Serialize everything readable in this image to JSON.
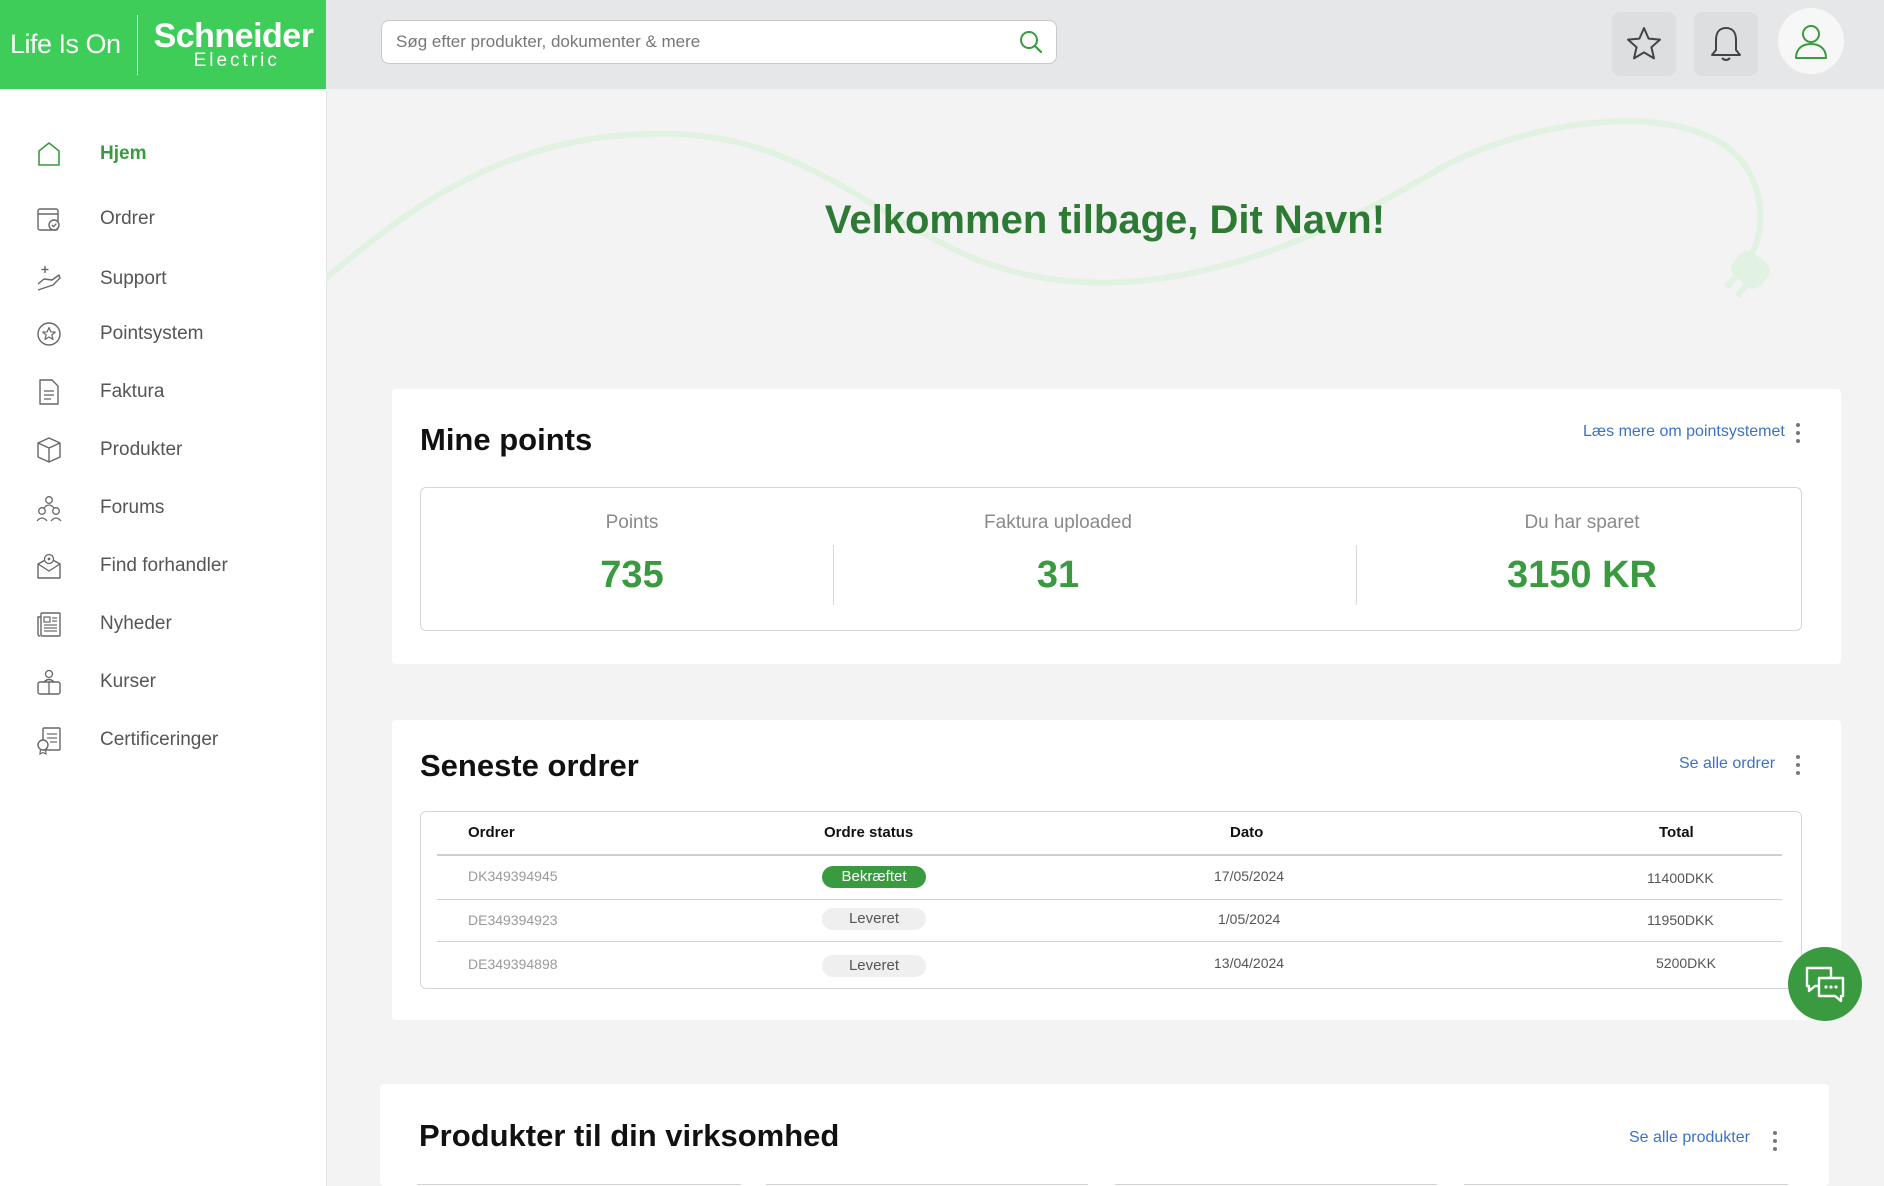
{
  "brand": {
    "tagline": "Life Is On",
    "name": "Schneider",
    "sub": "Electric",
    "primary_color": "#3dcd58",
    "accent_green": "#3a9a3f"
  },
  "search": {
    "placeholder": "Søg efter produkter, dokumenter & mere",
    "icon": "search-icon"
  },
  "topbar": {
    "icons": [
      "star-icon",
      "bell-icon",
      "user-icon"
    ]
  },
  "sidebar": {
    "items": [
      {
        "label": "Hjem",
        "icon": "home-icon",
        "active": true
      },
      {
        "label": "Ordrer",
        "icon": "orders-icon"
      },
      {
        "label": "Support",
        "icon": "support-icon"
      },
      {
        "label": "Pointsystem",
        "icon": "star-badge-icon"
      },
      {
        "label": "Faktura",
        "icon": "invoice-icon"
      },
      {
        "label": "Produkter",
        "icon": "box-icon"
      },
      {
        "label": "Forums",
        "icon": "people-icon"
      },
      {
        "label": "Find forhandler",
        "icon": "dealer-map-icon"
      },
      {
        "label": "Nyheder",
        "icon": "news-icon"
      },
      {
        "label": "Kurser",
        "icon": "courses-icon"
      },
      {
        "label": "Certificeringer",
        "icon": "certificate-icon"
      }
    ]
  },
  "main": {
    "welcome": "Velkommen tilbage, Dit Navn!",
    "points": {
      "title": "Mine points",
      "link": "Læs mere om pointsystemet",
      "stats": [
        {
          "label": "Points",
          "value": "735"
        },
        {
          "label": "Faktura uploaded",
          "value": "31"
        },
        {
          "label": "Du har sparet",
          "value": "3150 KR"
        }
      ]
    },
    "orders": {
      "title": "Seneste ordrer",
      "link": "Se alle ordrer",
      "columns": [
        "Ordrer",
        "Ordre status",
        "Dato",
        "Total"
      ],
      "rows": [
        {
          "id": "DK349394945",
          "status": "Bekræftet",
          "status_type": "confirmed",
          "date": "17/05/2024",
          "total": "11400DKK"
        },
        {
          "id": "DE349394923",
          "status": "Leveret",
          "status_type": "delivered",
          "date": "1/05/2024",
          "total": "11950DKK"
        },
        {
          "id": "DE349394898",
          "status": "Leveret",
          "status_type": "delivered",
          "date": "13/04/2024",
          "total": "5200DKK"
        }
      ]
    },
    "products": {
      "title": "Produkter til din virksomhed",
      "link": "Se alle produkter"
    }
  },
  "chat": {
    "icon": "chat-icon"
  }
}
